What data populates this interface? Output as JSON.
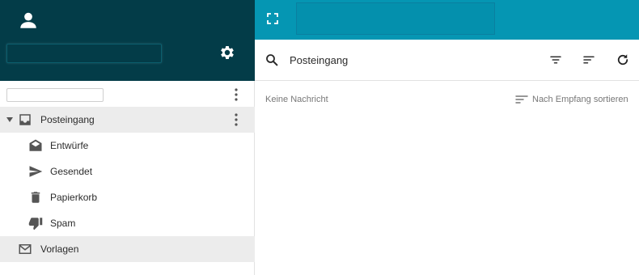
{
  "folders": {
    "inbox_label": "Posteingang",
    "drafts_label": "Entwürfe",
    "sent_label": "Gesendet",
    "trash_label": "Papierkorb",
    "spam_label": "Spam",
    "templates_label": "Vorlagen"
  },
  "main": {
    "search_value": "Posteingang",
    "empty_text": "Keine Nachricht",
    "sort_label": "Nach Empfang sortieren"
  },
  "colors": {
    "sidebar_header_bg": "#033c48",
    "topbar_bg": "#0596b3",
    "selected_row_bg": "#ececec",
    "icon_gray": "#555555"
  }
}
